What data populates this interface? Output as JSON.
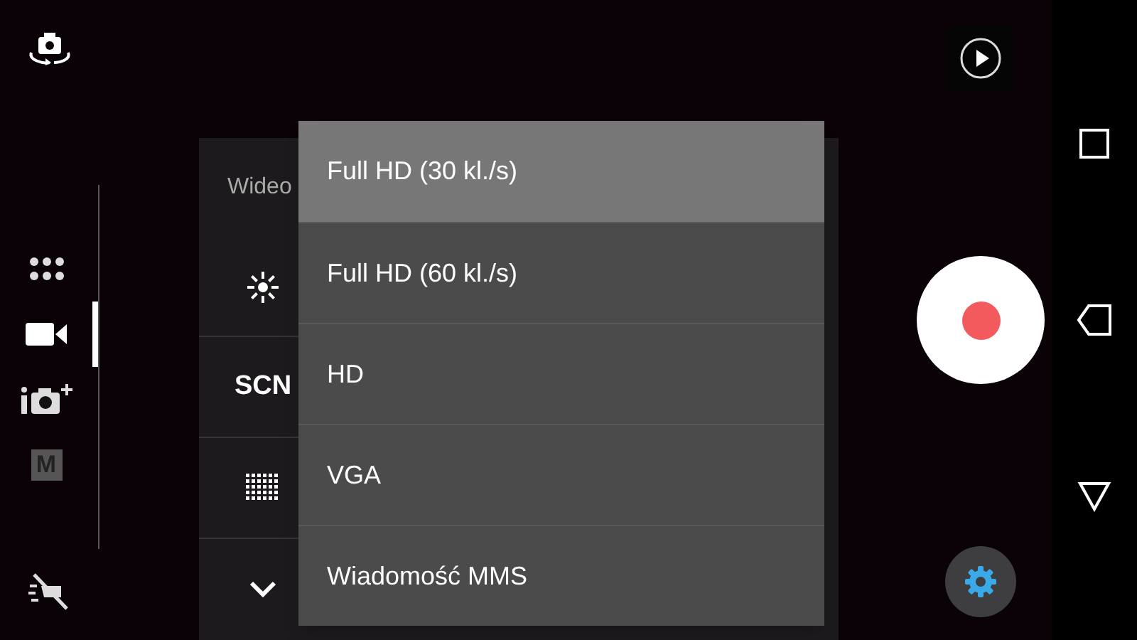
{
  "modes": [
    {
      "kind": "grid",
      "selected": false
    },
    {
      "kind": "video",
      "selected": true
    },
    {
      "kind": "superior-auto",
      "selected": false
    },
    {
      "kind": "manual",
      "label": "M",
      "selected": false
    }
  ],
  "settings": {
    "title": "Wideo",
    "scene": "SCN"
  },
  "resolution_menu": [
    {
      "label": "Full HD (30 kl./s)",
      "selected": true
    },
    {
      "label": "Full HD (60 kl./s)",
      "selected": false
    },
    {
      "label": "HD",
      "selected": false
    },
    {
      "label": "VGA",
      "selected": false
    },
    {
      "label": "Wiadomość MMS",
      "selected": false
    }
  ]
}
